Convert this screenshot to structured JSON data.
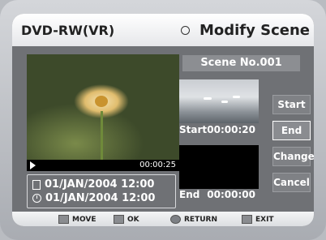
{
  "header": {
    "left_title": "DVD-RW(VR)",
    "right_title": "Modify Scene"
  },
  "player": {
    "time": "00:00:25"
  },
  "info": {
    "date_line_1": "01/JAN/2004 12:00",
    "date_line_2": "01/JAN/2004 12:00"
  },
  "scene": {
    "title": "Scene No.001"
  },
  "start": {
    "label": "Start",
    "time": "00:00:20"
  },
  "end": {
    "label": "End",
    "time": "00:00:00"
  },
  "buttons": {
    "start": "Start",
    "end": "End",
    "change": "Change",
    "cancel": "Cancel"
  },
  "footer": {
    "move": "MOVE",
    "ok": "OK",
    "return": "RETURN",
    "exit": "EXIT"
  }
}
